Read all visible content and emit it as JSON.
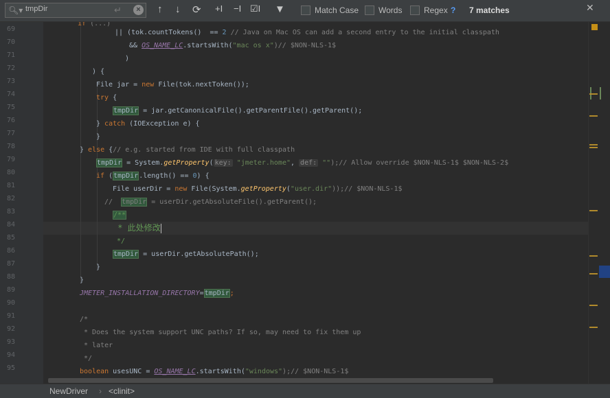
{
  "find_bar": {
    "query": "tmpDir",
    "match_case_label": "Match Case",
    "words_label": "Words",
    "regex_label": "Regex",
    "regex_help": "?",
    "match_count": "7 matches",
    "icons": [
      "search-icon",
      "enter-icon",
      "clear-icon",
      "prev-match-icon",
      "next-match-icon",
      "find-all-icon",
      "add-selection-icon",
      "remove-selection-icon",
      "select-all-icon",
      "filter-icon",
      "close-icon"
    ]
  },
  "lines": [
    {
      "num": "69",
      "text": "      if (...)"
    },
    {
      "num": "70",
      "text": ""
    },
    {
      "num": "71",
      "text": ""
    }
  ],
  "line_numbers": [
    "69",
    "70",
    "71",
    "72",
    "73",
    "74",
    "75",
    "76",
    "77",
    "78",
    "79",
    "80",
    "81",
    "82",
    "83",
    "84",
    "85",
    "86",
    "87",
    "88",
    "89",
    "90",
    "91",
    "92",
    "93",
    "94",
    "95"
  ],
  "code": {
    "l70_a": "|| (tok.countTokens()  == ",
    "l70_num": "2",
    "l70_comment": " // Java on Mac OS can add a second entry to the initial classpath",
    "l71_a": "&& ",
    "l71_field": "OS_NAME_LC",
    "l71_b": ".startsWith(",
    "l71_str": "\"mac os x\"",
    "l71_c": ")// $NON-NLS-1$",
    "l72": ")",
    "l73": ") {",
    "l74_a": "File jar = ",
    "l74_kw": "new",
    "l74_b": " File(tok.nextToken());",
    "l75_kw": "try",
    "l75_b": " {",
    "l76_var": "tmpDir",
    "l76_b": " = jar.getCanonicalFile().getParentFile().getParent();",
    "l77_a": "} ",
    "l77_kw": "catch",
    "l77_b": " (IOException e) {",
    "l78": "}",
    "l79_a": "} ",
    "l79_kw": "else",
    "l79_b": " {",
    "l79_comment": "// e.g. started from IDE with full classpath",
    "l80_var": "tmpDir",
    "l80_b": " = System.",
    "l80_m": "getProperty",
    "l80_c": "(",
    "l80_hint1": "key:",
    "l80_str1": " \"jmeter.home\"",
    "l80_d": ", ",
    "l80_hint2": "def:",
    "l80_str2": " \"\"",
    "l80_comment": ");// Allow override $NON-NLS-1$ $NON-NLS-2$",
    "l81_kw": "if",
    "l81_a": " (",
    "l81_var": "tmpDir",
    "l81_b": ".length() == ",
    "l81_num": "0",
    "l81_c": ") {",
    "l82_a": "File userDir = ",
    "l82_kw": "new",
    "l82_b": " File(System.",
    "l82_m": "getProperty",
    "l82_c": "(",
    "l82_str": "\"user.dir\"",
    "l82_comment": "));// $NON-NLS-1$",
    "l83_a": "//  ",
    "l83_var": "tmpDir",
    "l83_b": " = userDir.getAbsoluteFile().getParent();",
    "l84": "/**",
    "l85": " * 此处修改",
    "l86": " */",
    "l87_var": "tmpDir",
    "l87_b": " = userDir.getAbsolutePath();",
    "l88": "}",
    "l89": "}",
    "l90_field": "JMETER_INSTALLATION_DIRECTORY",
    "l90_eq": "=",
    "l90_var": "tmpDir",
    "l90_semi": ";",
    "l92": "/*",
    "l93": " * Does the system support UNC paths? If so, may need to fix them up",
    "l94": " * later",
    "l95": " */",
    "l96_kw": "boolean",
    "l96_a": " usesUNC = ",
    "l96_field": "OS_NAME_LC",
    "l96_b": ".startsWith(",
    "l96_str": "\"windows\"",
    "l96_comment": ");// $NON-NLS-1$"
  },
  "breadcrumb": {
    "class_name": "NewDriver",
    "separator": "›",
    "method_name": "<clinit>"
  }
}
